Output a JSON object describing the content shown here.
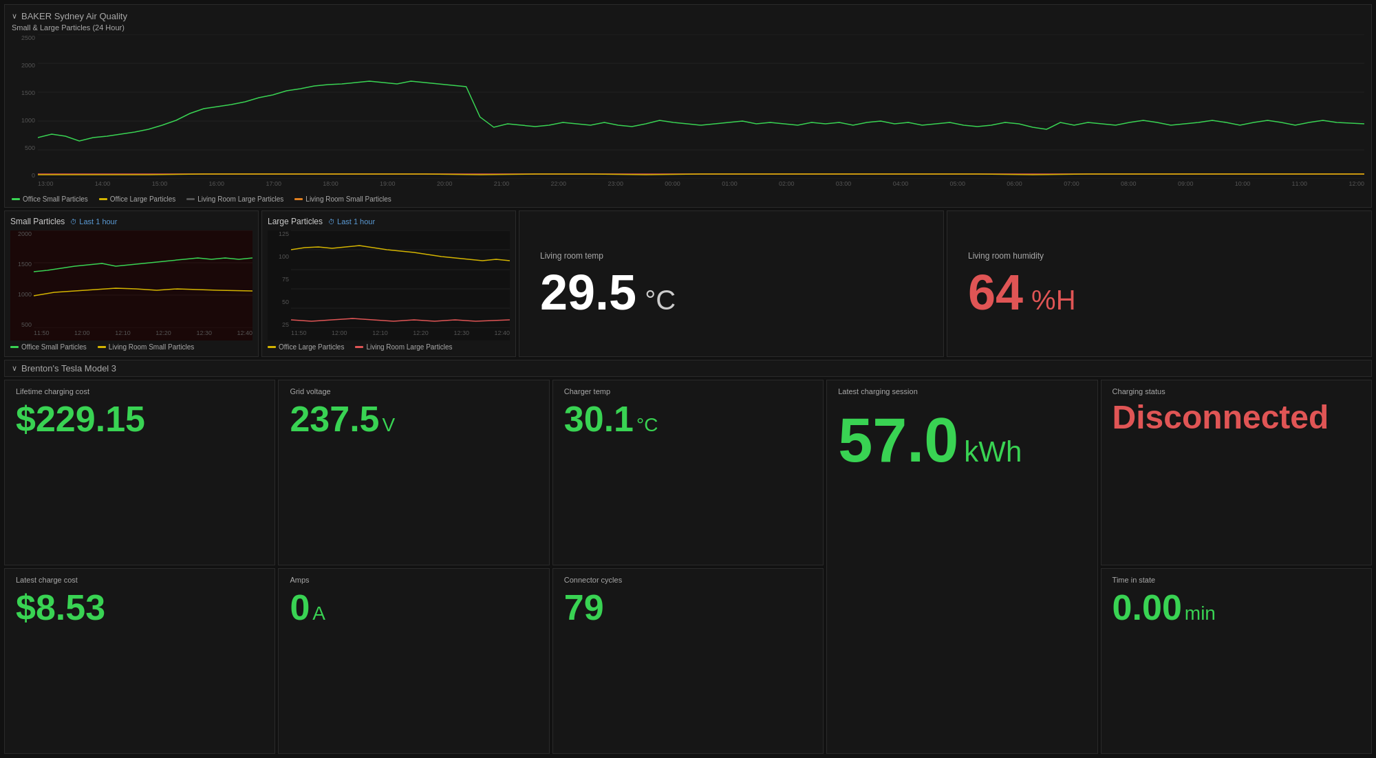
{
  "airQuality": {
    "sectionTitle": "BAKER Sydney Air Quality",
    "chartLabel": "Small & Large Particles (24 Hour)",
    "yLabels": [
      "2500",
      "2000",
      "1500",
      "1000",
      "500",
      "0"
    ],
    "xLabels": [
      "13:00",
      "14:00",
      "15:00",
      "16:00",
      "17:00",
      "18:00",
      "19:00",
      "20:00",
      "21:00",
      "22:00",
      "23:00",
      "00:00",
      "01:00",
      "02:00",
      "03:00",
      "04:00",
      "05:00",
      "06:00",
      "07:00",
      "08:00",
      "09:00",
      "10:00",
      "11:00",
      "12:00"
    ],
    "legend": [
      {
        "label": "Office Small Particles",
        "color": "#39d353"
      },
      {
        "label": "Office Large Particles",
        "color": "#d4b400"
      },
      {
        "label": "Living Room Large Particles",
        "color": "#555"
      },
      {
        "label": "Living Room Small Particles",
        "color": "#e08020"
      }
    ]
  },
  "smallParticles": {
    "title": "Small Particles",
    "timeBadge": "Last 1 hour",
    "yLabels": [
      "2000",
      "1500",
      "1000",
      "500"
    ],
    "xLabels": [
      "11:50",
      "12:00",
      "12:10",
      "12:20",
      "12:30",
      "12:40"
    ],
    "legend": [
      {
        "label": "Office Small Particles",
        "color": "#39d353"
      },
      {
        "label": "Living Room Small Particles",
        "color": "#d4b400"
      }
    ]
  },
  "largeParticles": {
    "title": "Large Particles",
    "timeBadge": "Last 1 hour",
    "yLabels": [
      "125",
      "100",
      "75",
      "50",
      "25"
    ],
    "xLabels": [
      "11:50",
      "12:00",
      "12:10",
      "12:20",
      "12:30",
      "12:40"
    ],
    "legend": [
      {
        "label": "Office Large Particles",
        "color": "#d4b400"
      },
      {
        "label": "Living Room Large Particles",
        "color": "#e05555"
      }
    ]
  },
  "livingRoomTemp": {
    "label": "Living room temp",
    "value": "29.5",
    "unit": "°C"
  },
  "livingRoomHumidity": {
    "label": "Living room humidity",
    "value": "64",
    "unit": "%H"
  },
  "tesla": {
    "sectionTitle": "Brenton's Tesla Model 3",
    "stats": [
      {
        "label": "Lifetime charging cost",
        "value": "$229.15",
        "unit": ""
      },
      {
        "label": "Grid voltage",
        "value": "237.5",
        "unit": "V"
      },
      {
        "label": "Charger temp",
        "value": "30.1",
        "unit": "°C"
      },
      {
        "label": "Latest charging session",
        "value": "57.0",
        "unit": "kWh",
        "large": true
      },
      {
        "label": "Charging status",
        "value": "Disconnected",
        "unit": "",
        "red": true
      }
    ],
    "statsBottom": [
      {
        "label": "Latest charge cost",
        "value": "$8.53",
        "unit": ""
      },
      {
        "label": "Amps",
        "value": "0",
        "unit": "A"
      },
      {
        "label": "Connector cycles",
        "value": "79",
        "unit": ""
      },
      {
        "label": "Time in state",
        "value": "0.00",
        "unit": "min"
      }
    ]
  }
}
